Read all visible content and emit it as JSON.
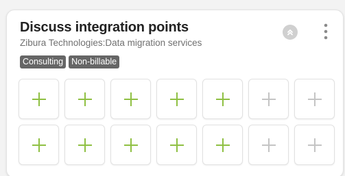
{
  "card": {
    "title": "Discuss integration points",
    "subtitle": "Zibura Technologies:Data migration services",
    "tags": [
      "Consulting",
      "Non-billable"
    ],
    "collapse_icon": "chevron-double-up-icon",
    "menu_icon": "more-vertical-icon"
  },
  "colors": {
    "active_plus": "#8fc043",
    "inactive_plus": "#c4c4c4",
    "tag_bg": "#666666"
  },
  "slots": {
    "rows": [
      [
        "active",
        "active",
        "active",
        "active",
        "active",
        "inactive",
        "inactive"
      ],
      [
        "active",
        "active",
        "active",
        "active",
        "active",
        "inactive",
        "inactive"
      ]
    ],
    "icon": "plus-icon"
  }
}
